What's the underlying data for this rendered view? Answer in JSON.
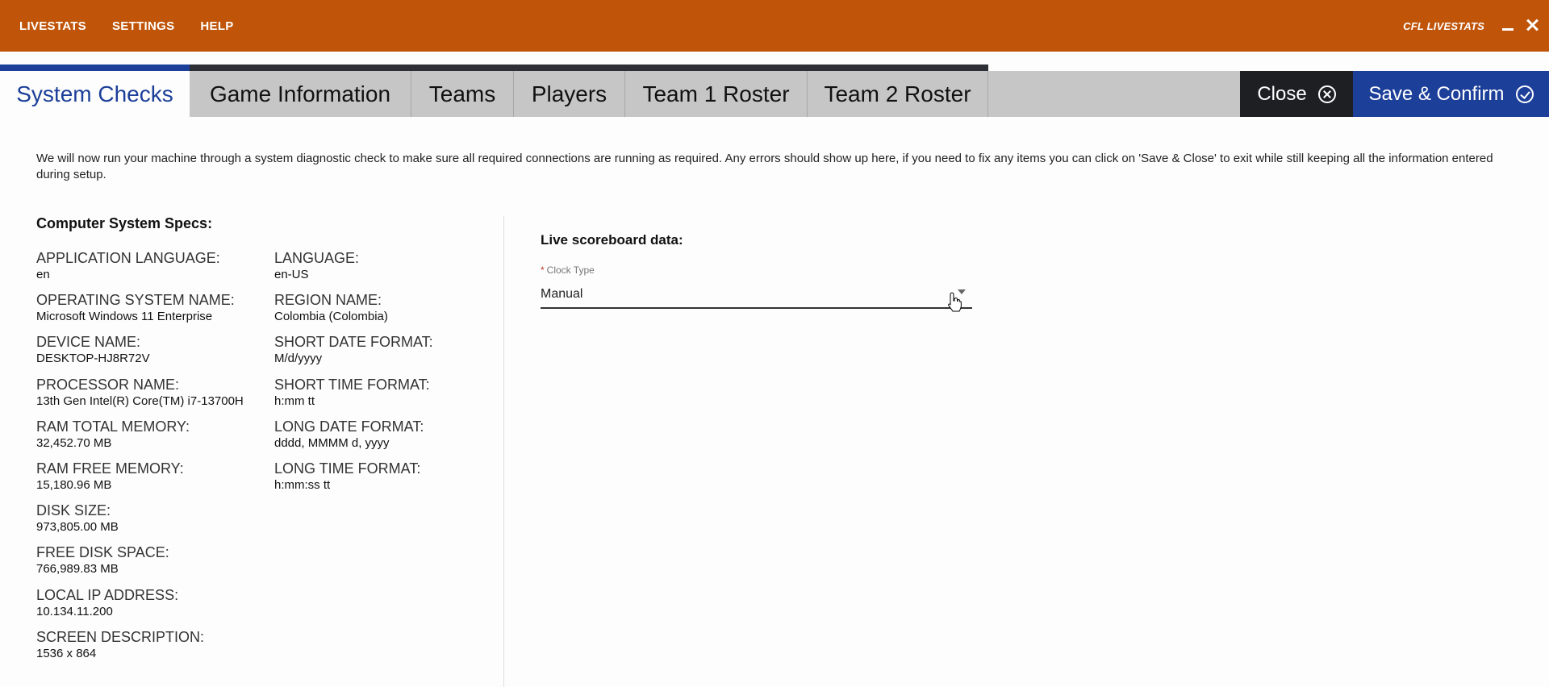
{
  "topbar": {
    "menu": [
      "LIVESTATS",
      "SETTINGS",
      "HELP"
    ],
    "brand": "CFL LIVESTATS",
    "color": "#c0550a"
  },
  "tabs": {
    "items": [
      "System Checks",
      "Game Information",
      "Teams",
      "Players",
      "Team 1 Roster",
      "Team 2 Roster"
    ],
    "active": "System Checks",
    "close_label": "Close",
    "save_label": "Save & Confirm",
    "accent": "#1c3f99"
  },
  "intro": "We will now run your machine through a system diagnostic check to make sure all required connections are running as required. Any errors should show up here, if you need to fix any items you can click on 'Save & Close' to exit while still keeping all the information entered during setup.",
  "specs": {
    "title": "Computer System Specs:",
    "left": [
      {
        "label": "APPLICATION LANGUAGE:",
        "value": "en"
      },
      {
        "label": "OPERATING SYSTEM NAME:",
        "value": "Microsoft Windows 11 Enterprise"
      },
      {
        "label": "DEVICE NAME:",
        "value": "DESKTOP-HJ8R72V"
      },
      {
        "label": "PROCESSOR NAME:",
        "value": "13th Gen Intel(R) Core(TM) i7-13700H"
      },
      {
        "label": "RAM TOTAL MEMORY:",
        "value": "32,452.70 MB"
      },
      {
        "label": "RAM FREE MEMORY:",
        "value": "15,180.96 MB"
      },
      {
        "label": "DISK SIZE:",
        "value": "973,805.00 MB"
      },
      {
        "label": "FREE DISK SPACE:",
        "value": "766,989.83 MB"
      },
      {
        "label": "LOCAL IP ADDRESS:",
        "value": "10.134.11.200"
      },
      {
        "label": "SCREEN DESCRIPTION:",
        "value": "1536 x 864"
      }
    ],
    "right": [
      {
        "label": "LANGUAGE:",
        "value": "en-US"
      },
      {
        "label": "REGION NAME:",
        "value": "Colombia (Colombia)"
      },
      {
        "label": "SHORT DATE FORMAT:",
        "value": "M/d/yyyy"
      },
      {
        "label": "SHORT TIME FORMAT:",
        "value": "h:mm tt"
      },
      {
        "label": "LONG DATE FORMAT:",
        "value": "dddd, MMMM d, yyyy"
      },
      {
        "label": "LONG TIME FORMAT:",
        "value": "h:mm:ss tt"
      }
    ]
  },
  "live": {
    "title": "Live scoreboard data:",
    "clock_label": "Clock Type",
    "required_mark": "*",
    "clock_value": "Manual"
  }
}
